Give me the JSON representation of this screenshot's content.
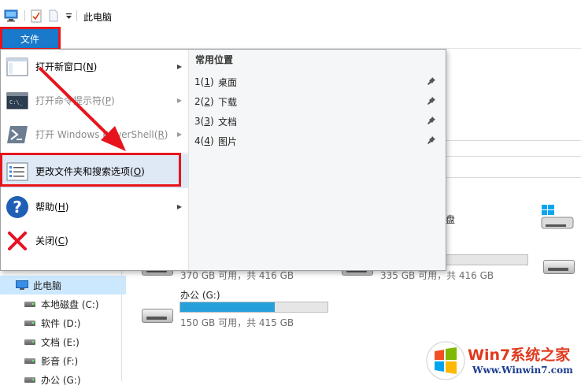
{
  "window": {
    "title": "此电脑"
  },
  "ribbon": {
    "file_tab": "文件"
  },
  "file_menu": {
    "items": [
      {
        "label": "打开新窗口(",
        "key": "N",
        "suffix": ")",
        "icon": "new-window-icon",
        "disabled": false,
        "submenu": true
      },
      {
        "label": "打开命令提示符(",
        "key": "P",
        "suffix": ")",
        "icon": "command-prompt-icon",
        "disabled": true,
        "submenu": true
      },
      {
        "label": "打开 Windows PowerShell(",
        "key": "R",
        "suffix": ")",
        "icon": "powershell-icon",
        "disabled": true,
        "submenu": true
      },
      {
        "label": "更改文件夹和搜索选项(",
        "key": "O",
        "suffix": ")",
        "icon": "folder-options-icon",
        "disabled": false,
        "submenu": false
      },
      {
        "label": "帮助(",
        "key": "H",
        "suffix": ")",
        "icon": "help-icon",
        "disabled": false,
        "submenu": true
      },
      {
        "label": "关闭(",
        "key": "C",
        "suffix": ")",
        "icon": "close-icon",
        "disabled": false,
        "submenu": false
      }
    ],
    "frequent_title": "常用位置",
    "frequent": [
      {
        "num": "1",
        "key": "1",
        "name": "桌面"
      },
      {
        "num": "2",
        "key": "2",
        "name": "下载"
      },
      {
        "num": "3",
        "key": "3",
        "name": "文档"
      },
      {
        "num": "4",
        "key": "4",
        "name": "图片"
      }
    ]
  },
  "nav": {
    "items": [
      {
        "label": "此电脑",
        "icon": "pc-icon"
      },
      {
        "label": "本地磁盘 (C:)",
        "icon": "drive-icon"
      },
      {
        "label": "软件 (D:)",
        "icon": "drive-icon"
      },
      {
        "label": "文档 (E:)",
        "icon": "drive-icon"
      },
      {
        "label": "影音 (F:)",
        "icon": "drive-icon"
      },
      {
        "label": "办公 (G:)",
        "icon": "drive-icon"
      }
    ]
  },
  "drives": {
    "partial_label": "盘",
    "c_capacity": "370 GB 可用，共 416 GB",
    "e_capacity": "335 GB 可用，共 416 GB",
    "g_name": "办公 (G:)",
    "g_capacity": "150 GB 可用，共 415 GB",
    "g_used_fraction": 0.64
  },
  "watermark": {
    "brand": "Win7系统之家",
    "url": "Www.Winwin7.com"
  },
  "colors": {
    "accent": "#1979ca",
    "annotation": "#e8141c",
    "progress": "#26a0da"
  }
}
